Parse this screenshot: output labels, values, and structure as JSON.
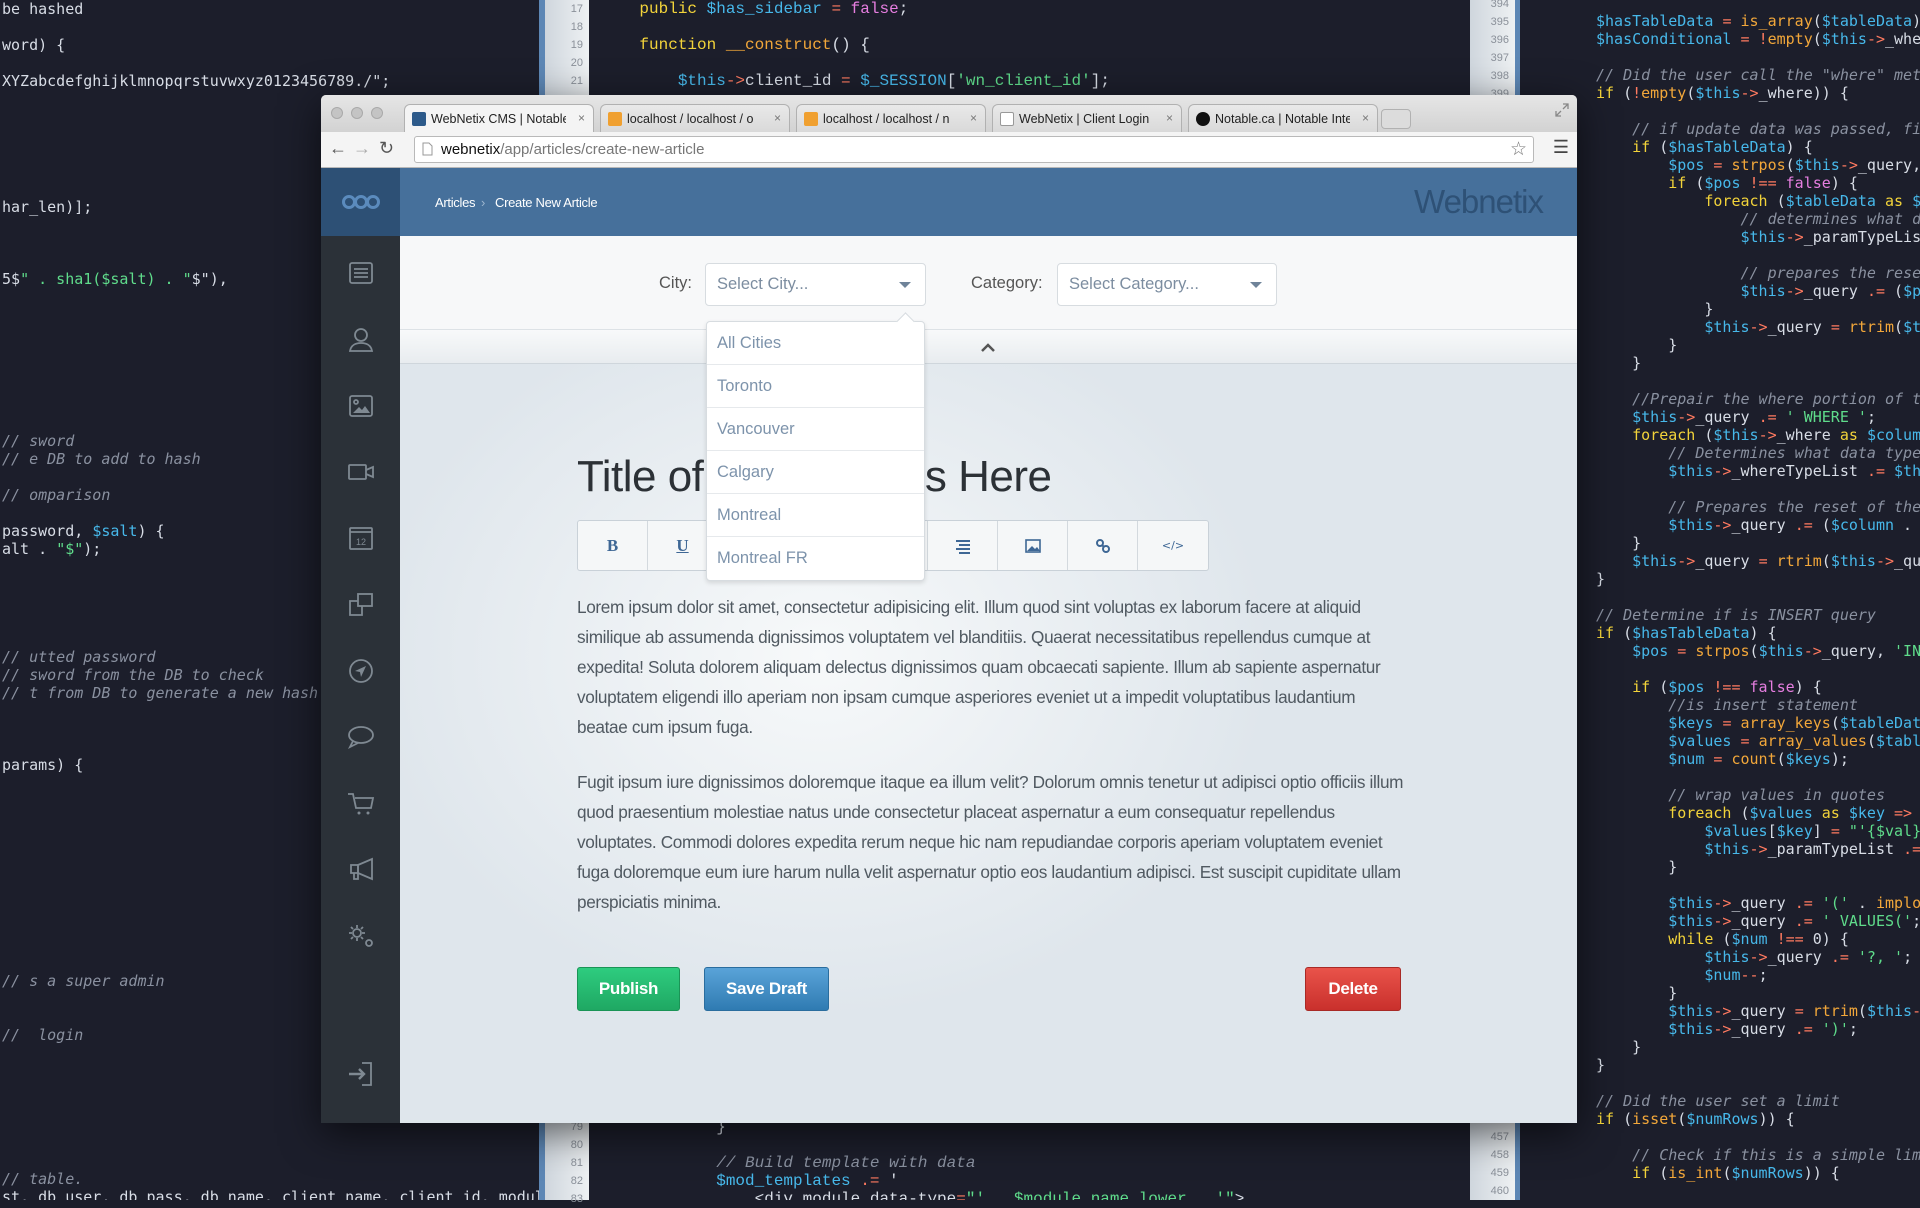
{
  "background_code": {
    "left": [
      "be hashed",
      "",
      "word) {",
      "",
      "XYZabcdefghijklmnopqrstuvwxyz0123456789./\";",
      "",
      "",
      "",
      "",
      "",
      "",
      "har_len)];",
      "",
      "",
      "",
      "5$\" . sha1($salt) . \"$\"),",
      "",
      "",
      "",
      "",
      "",
      "",
      "",
      "",
      "// sword",
      "// e DB to add to hash",
      "",
      "// omparison",
      "",
      "password, $salt) {",
      "alt . \"$\");",
      "",
      "",
      "",
      "",
      "",
      "// utted password",
      "// sword from the DB to check",
      "// t from DB to generate a new hash for",
      "",
      "",
      "",
      "params) {",
      "",
      "",
      "",
      "",
      "",
      "",
      "",
      "",
      "",
      "",
      "",
      "// s a super admin",
      "",
      "",
      "//  login",
      "",
      "",
      "",
      "",
      "",
      "",
      "",
      "// table.",
      "st, db_user, db_pass, db_name, client_name, client_id, module"
    ],
    "middle_top_numbers": [
      "17",
      "18",
      "19",
      "20",
      "21"
    ],
    "middle_top": [
      "    public $has_sidebar = false;",
      "",
      "    function __construct() {",
      "",
      "        $this->client_id = $_SESSION['wn_client_id'];"
    ],
    "middle_bottom_numbers": [
      "79",
      "80",
      "81",
      "82",
      "83"
    ],
    "middle_bottom": [
      "            }",
      "",
      "            // Build template with data",
      "            $mod_templates .= '",
      "                <div module data-type=\"' . $module_name_lower . '\">"
    ],
    "right_top_numbers": [
      "394",
      "395",
      "396",
      "397",
      "398",
      "399"
    ],
    "right_bottom_numbers": [
      "457",
      "458",
      "459",
      "460"
    ],
    "right": [
      "$hasTableData = is_array($tableData);",
      "$hasConditional = !empty($this->_where);",
      "",
      "// Did the user call the \"where\" method?",
      "if (!empty($this->_where)) {",
      "",
      "    // if update data was passed, filter through",
      "    if ($hasTableData) {",
      "        $pos = strpos($this->_query, 'UPDATE');",
      "        if ($pos !== false) {",
      "            foreach ($tableData as $prop => $value) {",
      "                // determines what data type",
      "                $this->_paramTypeList .= $this->_determineType($value);",
      "",
      "                // prepares the reset of the SQL query",
      "                $this->_query .= ($prop . ' = ?, ');",
      "            }",
      "            $this->_query = rtrim($this->_query, ', ');",
      "        }",
      "    }",
      "",
      "    //Prepair the where portion of the query",
      "    $this->_query .= ' WHERE ';",
      "    foreach ($this->_where as $column => $value) {",
      "        // Determines what data type the where column is",
      "        $this->_whereTypeList .= $this->_determineType($value);",
      "",
      "        // Prepares the reset of the SQL query",
      "        $this->_query .= ($column . ' = ? AND ');",
      "    }",
      "    $this->_query = rtrim($this->_query, ' AND ');",
      "}",
      "",
      "// Determine if is INSERT query",
      "if ($hasTableData) {",
      "    $pos = strpos($this->_query, 'INSERT');",
      "",
      "    if ($pos !== false) {",
      "        //is insert statement",
      "        $keys = array_keys($tableData);",
      "        $values = array_values($tableData);",
      "        $num = count($keys);",
      "",
      "        // wrap values in quotes",
      "        foreach ($values as $key => $val) {",
      "            $values[$key] = \"'{$val}'\";",
      "            $this->_paramTypeList .= $this->_determineType($val);",
      "        }",
      "",
      "        $this->_query .= '(' . implode($keys, ', ') . ')';",
      "        $this->_query .= ' VALUES(';",
      "        while ($num !== 0) {",
      "            $this->_query .= '?, ';",
      "            $num--;",
      "        }",
      "        $this->_query = rtrim($this->_query, ', ');",
      "        $this->_query .= ')';",
      "    }",
      "}",
      "",
      "// Did the user set a limit",
      "if (isset($numRows)) {",
      "",
      "    // Check if this is a simple limit",
      "    if (is_int($numRows)) {"
    ]
  },
  "browser": {
    "tabs": [
      {
        "label": "WebNetix CMS | Notable",
        "favicon": "webnetix-icon",
        "active": true
      },
      {
        "label": "localhost / localhost / o",
        "favicon": "phpmyadmin-icon",
        "active": false
      },
      {
        "label": "localhost / localhost / n",
        "favicon": "phpmyadmin-icon",
        "active": false
      },
      {
        "label": "WebNetix | Client Login",
        "favicon": "page-icon",
        "active": false
      },
      {
        "label": "Notable.ca | Notable Inte",
        "favicon": "notable-icon",
        "active": false
      }
    ],
    "close_glyph": "×",
    "url_host": "webnetix",
    "url_path": "/app/articles/create-new-article"
  },
  "header": {
    "breadcrumb": [
      "Articles",
      "Create New Article"
    ],
    "breadcrumb_separator": "›",
    "brand": "Webnetix",
    "color": "#46709b"
  },
  "sidebar": {
    "items": [
      "articles-icon",
      "users-icon",
      "images-icon",
      "video-icon",
      "calendar-icon",
      "pages-icon",
      "navigation-icon",
      "comments-icon",
      "cart-icon",
      "announcements-icon",
      "settings-icon"
    ],
    "calendar_day": "12",
    "logout": "logout-icon"
  },
  "filters": {
    "city_label": "City:",
    "city_placeholder": "Select City...",
    "category_label": "Category:",
    "category_placeholder": "Select Category...",
    "city_options": [
      "All Cities",
      "Toronto",
      "Vancouver",
      "Calgary",
      "Montreal",
      "Montreal FR"
    ]
  },
  "editor": {
    "title": "Title of Article Goes Here",
    "toolbar": [
      {
        "icon": "bold-icon",
        "glyph": "B"
      },
      {
        "icon": "underline-icon",
        "glyph": "U"
      },
      {
        "icon": "italic-icon",
        "glyph": ""
      },
      {
        "icon": "align-left-icon",
        "glyph": ""
      },
      {
        "icon": "align-center-icon",
        "glyph": ""
      },
      {
        "icon": "align-right-icon",
        "glyph": ""
      },
      {
        "icon": "image-icon",
        "glyph": ""
      },
      {
        "icon": "link-icon",
        "glyph": ""
      },
      {
        "icon": "code-icon",
        "glyph": "</>"
      }
    ],
    "paragraphs": [
      "Lorem ipsum dolor sit amet, consectetur adipisicing elit. Illum quod sint voluptas ex laborum facere at aliquid similique ab assumenda dignissimos voluptatem vel blanditiis. Quaerat necessitatibus repellendus cumque at expedita! Soluta dolorem aliquam delectus dignissimos quam obcaecati sapiente. Illum ab sapiente aspernatur voluptatem eligendi illo aperiam non ipsam cumque asperiores eveniet ut a impedit voluptatibus laudantium beatae cum ipsum fuga.",
      "Fugit ipsum iure dignissimos doloremque itaque ea illum velit? Dolorum omnis tenetur ut adipisci optio officiis illum quod praesentium molestiae natus unde consectetur placeat aspernatur a eum consequatur repellendus voluptates. Commodi dolores expedita rerum neque hic nam repudiandae corporis aperiam voluptatem eveniet fuga doloremque eum iure harum nulla velit aspernatur optio eos laudantium adipisci. Est suscipit cupiditate ullam perspiciatis minima."
    ]
  },
  "actions": {
    "publish": "Publish",
    "save_draft": "Save Draft",
    "delete": "Delete",
    "colors": {
      "publish": "#27b86f",
      "save_draft": "#3f8dc4",
      "delete": "#d9403a"
    }
  }
}
